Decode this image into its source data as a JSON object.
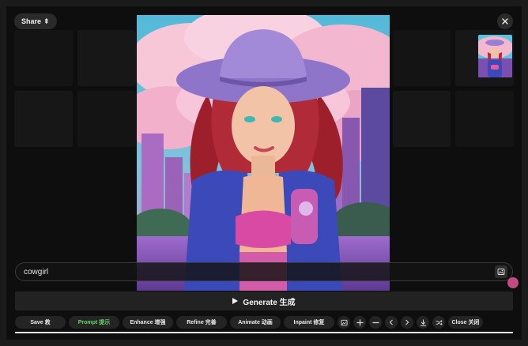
{
  "header": {
    "share_label": "Share",
    "share_glyph": "⇞"
  },
  "image": {
    "subject": "cowgirl"
  },
  "prompt": {
    "value": "cowgirl"
  },
  "generate": {
    "label": "Generate 生成"
  },
  "toolbar": {
    "save": "Save 救",
    "prompt": "Prompt 提示",
    "enhance": "Enhance 增强",
    "refine": "Refine 完善",
    "animate": "Animate 动画",
    "inpaint": "Inpaint 修复",
    "close": "Close 关闭"
  },
  "colors": {
    "accent_green": "#6ad36a",
    "accent_pink": "#c34a7f"
  },
  "icons": [
    "image-icon",
    "plus-icon",
    "minus-icon",
    "chevron-left-icon",
    "chevron-right-icon",
    "download-icon",
    "shuffle-icon",
    "close-icon"
  ]
}
